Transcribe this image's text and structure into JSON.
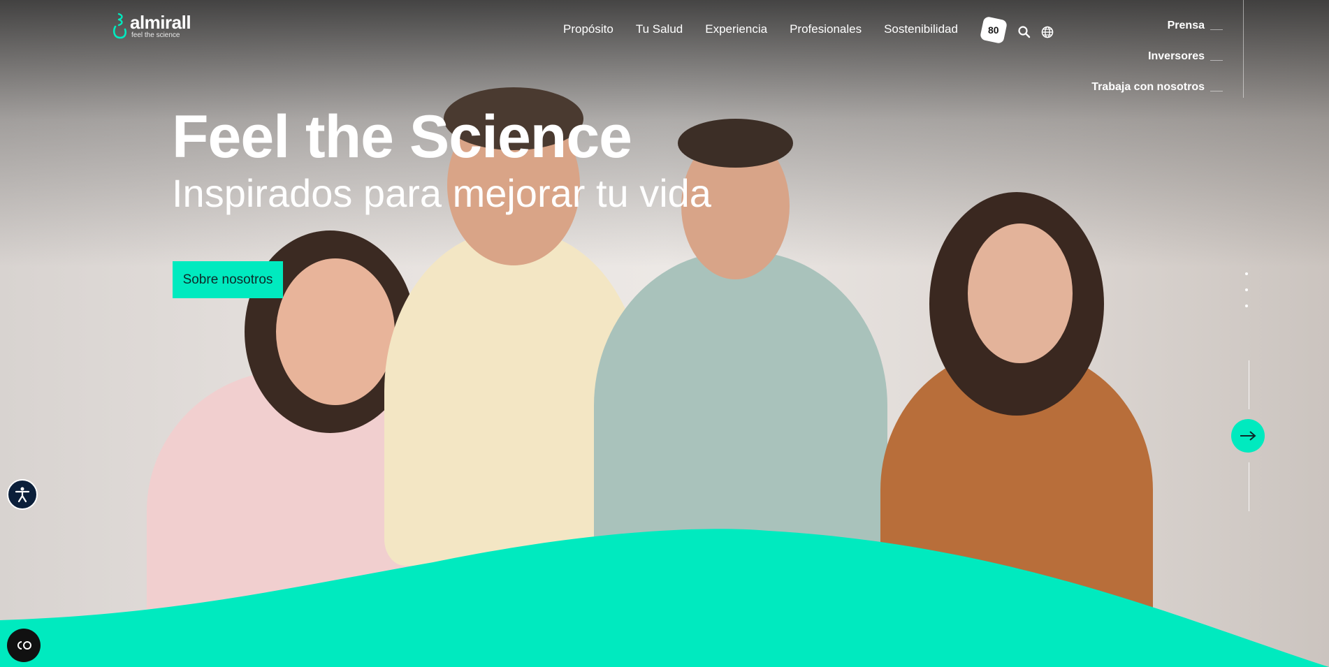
{
  "brand": {
    "name": "almirall",
    "tagline": "feel the science",
    "accent": "#00eabf"
  },
  "nav": {
    "items": [
      "Propósito",
      "Tu Salud",
      "Experiencia",
      "Profesionales",
      "Sostenibilidad"
    ],
    "badge": "80",
    "search_icon": "search-icon",
    "language_icon": "globe-icon"
  },
  "side_nav": [
    "Prensa",
    "Inversores",
    "Trabaja con nosotros"
  ],
  "hero": {
    "title": "Feel the Science",
    "subtitle": "Inspirados para mejorar tu vida",
    "cta": "Sobre nosotros"
  },
  "controls": {
    "next_icon": "arrow-right-icon",
    "accessibility_icon": "accessibility-icon",
    "cookie_icon": "cookie-settings-icon"
  }
}
